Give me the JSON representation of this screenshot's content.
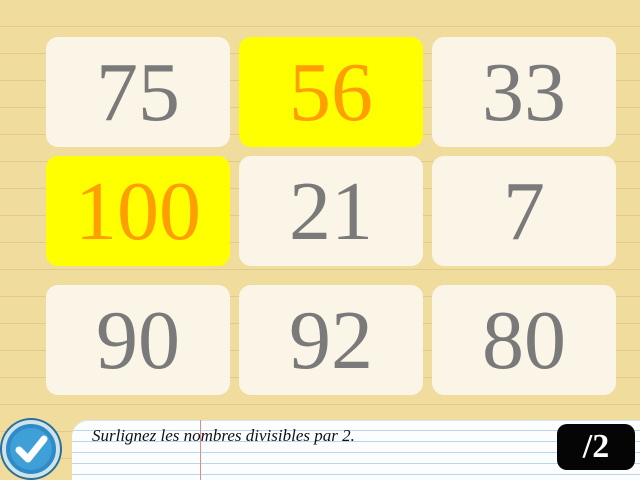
{
  "tiles": [
    {
      "value": "75",
      "selected": false
    },
    {
      "value": "56",
      "selected": true
    },
    {
      "value": "33",
      "selected": false
    },
    {
      "value": "100",
      "selected": true
    },
    {
      "value": "21",
      "selected": false
    },
    {
      "value": "7",
      "selected": false
    },
    {
      "value": "90",
      "selected": false
    },
    {
      "value": "92",
      "selected": false
    },
    {
      "value": "80",
      "selected": false
    }
  ],
  "instruction": "Surlignez les nombres divisibles par 2.",
  "score_label": "/2",
  "validate_icon": "checkmark-icon",
  "colors": {
    "selected_bg": "#ffff00",
    "selected_text": "#ff9e00",
    "tile_bg": "#fbf5e8",
    "tile_text": "#7a7a7a",
    "validate_button": "#2e8bc8"
  }
}
